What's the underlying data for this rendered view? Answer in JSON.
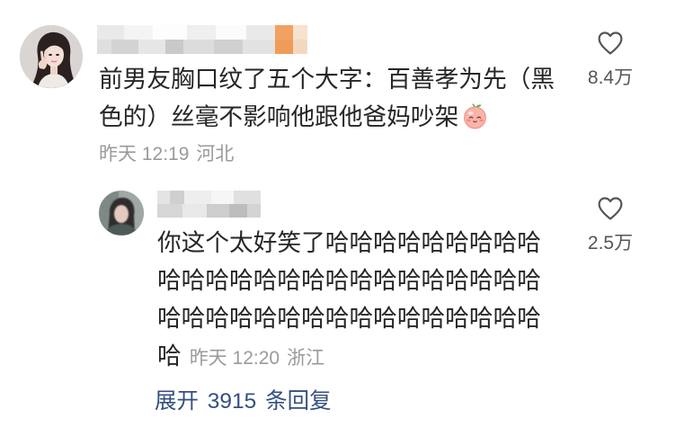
{
  "comment": {
    "lines": [
      "前男友胸口纹了五个大字：百善孝为先（黑",
      "色的）丝毫不影响他跟他爸妈吵架"
    ],
    "emoji": "peach-face-emoji-icon",
    "time": "昨天 12:19",
    "location": "河北",
    "like_icon": "heart-outline-icon",
    "like_count": "8.4万"
  },
  "reply": {
    "lines": [
      "你这个太好笑了哈哈哈哈哈哈哈哈哈",
      "哈哈哈哈哈哈哈哈哈哈哈哈哈哈哈哈",
      "哈哈哈哈哈哈哈哈哈哈哈哈哈哈哈哈",
      "哈"
    ],
    "time": "昨天 12:20",
    "location": "浙江",
    "like_icon": "heart-outline-icon",
    "like_count": "2.5万"
  },
  "expand_replies": {
    "label": "展开 3915 条回复"
  },
  "colors": {
    "text": "#262626",
    "meta": "#9a9a9a",
    "like": "#555555",
    "link": "#34507f",
    "background": "#ffffff"
  }
}
